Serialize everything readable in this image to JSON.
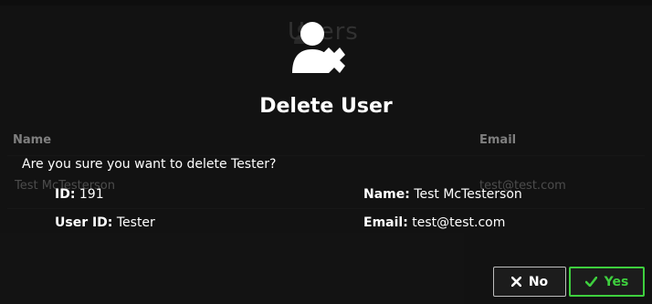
{
  "background": {
    "page_title": "Users",
    "table": {
      "headers": {
        "name": "Name",
        "email": "Email"
      },
      "row": {
        "name": "Test McTesterson",
        "email": "test@test.com"
      }
    }
  },
  "modal": {
    "icon": "delete-user-icon",
    "title": "Delete User",
    "question": "Are you sure you want to delete Tester?",
    "fields": {
      "id_label": "ID:",
      "id_value": "191",
      "name_label": "Name:",
      "name_value": "Test McTesterson",
      "userid_label": "User ID:",
      "userid_value": "Tester",
      "email_label": "Email:",
      "email_value": "test@test.com"
    },
    "buttons": {
      "no_label": "No",
      "no_icon": "x-icon",
      "yes_label": "Yes",
      "yes_icon": "check-icon"
    }
  },
  "colors": {
    "accent_yes": "#3ecf3e"
  }
}
